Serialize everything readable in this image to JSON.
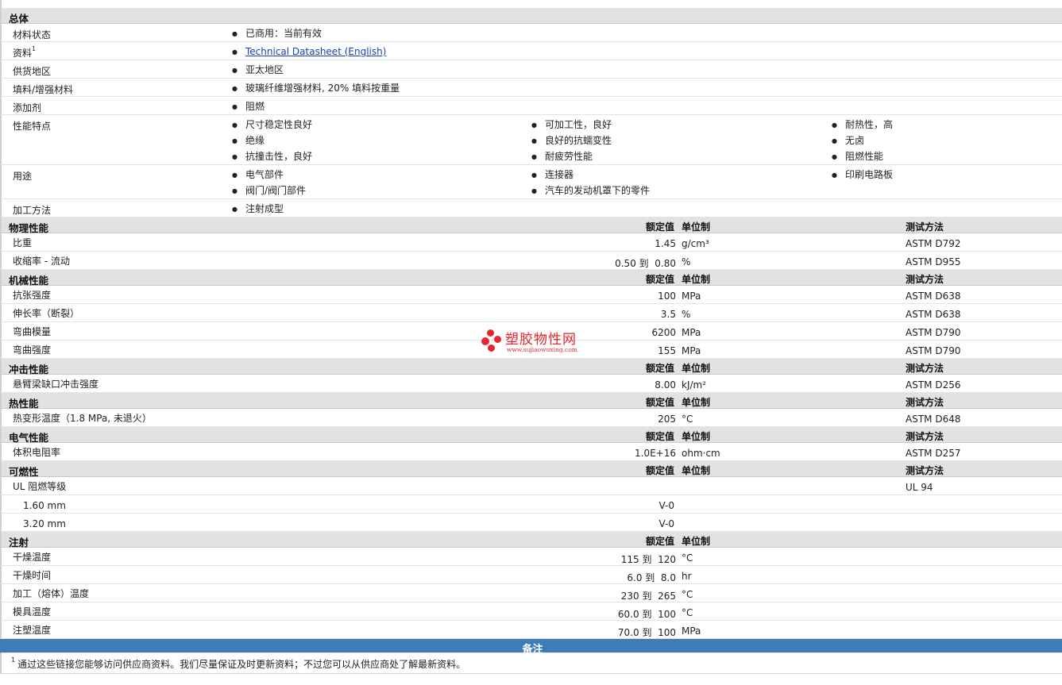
{
  "general": {
    "title": "总体",
    "rows": [
      {
        "label": "材料状态",
        "cols": [
          [
            "已商用：当前有效"
          ]
        ]
      },
      {
        "label": "资料",
        "sup": "1",
        "link": true,
        "cols": [
          [
            "Technical Datasheet (English)"
          ]
        ]
      },
      {
        "label": "供货地区",
        "cols": [
          [
            "亚太地区"
          ]
        ]
      },
      {
        "label": "填料/增强材料",
        "cols": [
          [
            "玻璃纤维增强材料, 20% 填料按重量"
          ]
        ]
      },
      {
        "label": "添加剂",
        "cols": [
          [
            "阻燃"
          ]
        ]
      },
      {
        "label": "性能特点",
        "cols": [
          [
            "尺寸稳定性良好",
            "绝缘",
            "抗撞击性，良好"
          ],
          [
            "可加工性，良好",
            "良好的抗蠕变性",
            "耐疲劳性能"
          ],
          [
            "耐热性，高",
            "无卤",
            "阻燃性能"
          ]
        ]
      },
      {
        "label": "用途",
        "cols": [
          [
            "电气部件",
            "阀门/阀门部件"
          ],
          [
            "连接器",
            "汽车的发动机罩下的零件"
          ],
          [
            "印刷电路板"
          ]
        ]
      },
      {
        "label": "加工方法",
        "cols": [
          [
            "注射成型"
          ]
        ]
      }
    ]
  },
  "sections": [
    {
      "title": "物理性能",
      "h1": "额定值",
      "h2": "单位制",
      "h3": "测试方法",
      "rows": [
        {
          "label": "比重",
          "value": "1.45",
          "unit": "g/cm³",
          "method": "ASTM D792"
        },
        {
          "label": "收缩率  - 流动",
          "value": "0.50 到  0.80",
          "unit": "%",
          "method": "ASTM D955"
        }
      ]
    },
    {
      "title": "机械性能",
      "h1": "额定值",
      "h2": "单位制",
      "h3": "测试方法",
      "rows": [
        {
          "label": "抗张强度",
          "value": "100",
          "unit": "MPa",
          "method": "ASTM D638"
        },
        {
          "label": "伸长率（断裂）",
          "value": "3.5",
          "unit": "%",
          "method": "ASTM D638"
        },
        {
          "label": "弯曲模量",
          "value": "6200",
          "unit": "MPa",
          "method": "ASTM D790"
        },
        {
          "label": "弯曲强度",
          "value": "155",
          "unit": "MPa",
          "method": "ASTM D790"
        }
      ]
    },
    {
      "title": "冲击性能",
      "h1": "额定值",
      "h2": "单位制",
      "h3": "测试方法",
      "rows": [
        {
          "label": "悬臂梁缺口冲击强度",
          "value": "8.00",
          "unit": "kJ/m²",
          "method": "ASTM D256"
        }
      ]
    },
    {
      "title": "热性能",
      "h1": "额定值",
      "h2": "单位制",
      "h3": "测试方法",
      "rows": [
        {
          "label": "热变形温度（1.8 MPa, 未退火）",
          "value": "205",
          "unit": "°C",
          "method": "ASTM D648"
        }
      ]
    },
    {
      "title": "电气性能",
      "h1": "额定值",
      "h2": "单位制",
      "h3": "测试方法",
      "rows": [
        {
          "label": "体积电阻率",
          "value": "1.0E+16",
          "unit": "ohm·cm",
          "method": "ASTM D257"
        }
      ]
    },
    {
      "title": "可燃性",
      "h1": "额定值",
      "h2": "单位制",
      "h3": "测试方法",
      "rows": [
        {
          "label": "UL 阻燃等级",
          "value": "",
          "unit": "",
          "method": "UL 94"
        },
        {
          "label": "1.60 mm",
          "indent": true,
          "value": "V-0",
          "center": true,
          "unit": "",
          "method": ""
        },
        {
          "label": "3.20 mm",
          "indent": true,
          "value": "V-0",
          "center": true,
          "unit": "",
          "method": ""
        }
      ]
    },
    {
      "title": "注射",
      "h1": "额定值",
      "h2": "单位制",
      "h3": "",
      "rows": [
        {
          "label": "干燥温度",
          "value": "115 到  120",
          "unit": "°C",
          "method": ""
        },
        {
          "label": "干燥时间",
          "value": "6.0 到  8.0",
          "unit": "hr",
          "method": ""
        },
        {
          "label": "加工（熔体）温度",
          "value": "230 到  265",
          "unit": "°C",
          "method": ""
        },
        {
          "label": "模具温度",
          "value": "60.0 到  100",
          "unit": "°C",
          "method": ""
        },
        {
          "label": "注塑温度",
          "value": "70.0 到  100",
          "unit": "MPa",
          "method": ""
        }
      ]
    }
  ],
  "notes": {
    "title": "备注",
    "sup": "1",
    "text": "通过这些链接您能够访问供应商资料。我们尽量保证及时更新资料；不过您可以从供应商处了解最新资料。"
  },
  "watermark": {
    "brand": "塑胶物性网",
    "url": "www.sujiaowuxing.com",
    "color": "#e8262e"
  }
}
